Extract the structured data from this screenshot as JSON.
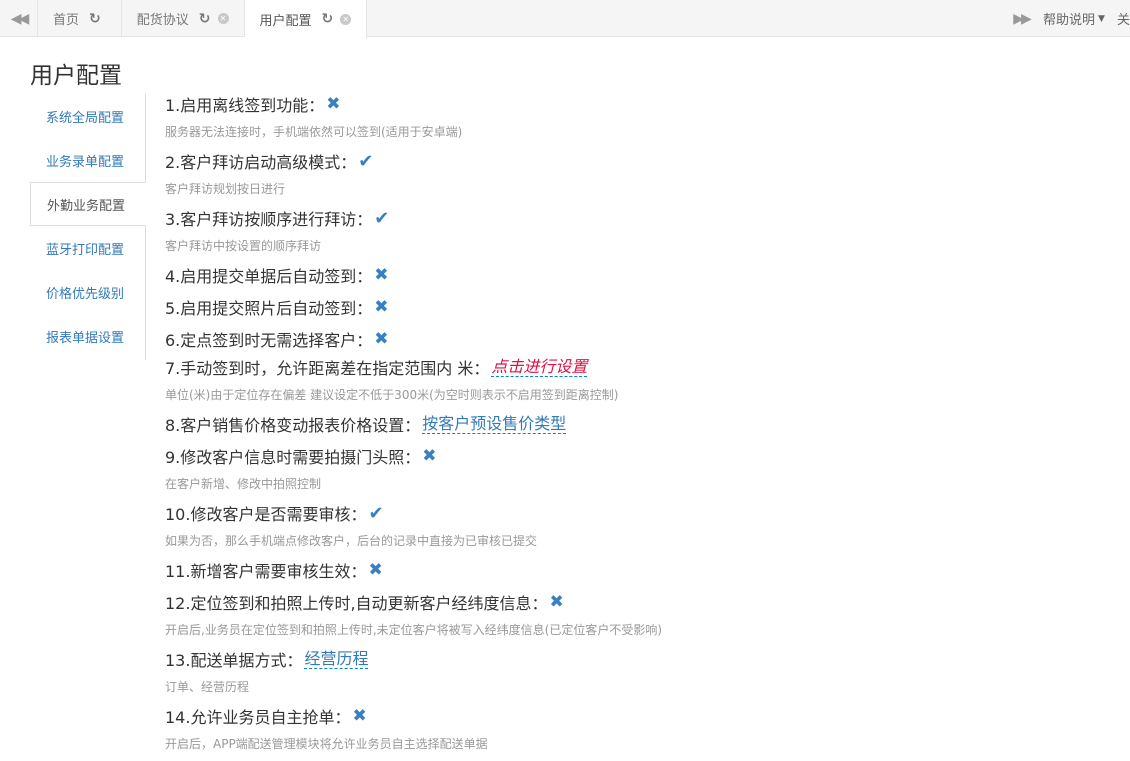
{
  "tabbar": {
    "tabs": [
      {
        "label": "首页",
        "closable": false
      },
      {
        "label": "配货协议",
        "closable": true
      },
      {
        "label": "用户配置",
        "closable": true,
        "active": true
      }
    ],
    "help_label": "帮助说明",
    "more_label": "关"
  },
  "page_title": "用户配置",
  "sidebar": {
    "items": [
      {
        "label": "系统全局配置"
      },
      {
        "label": "业务录单配置"
      },
      {
        "label": "外勤业务配置",
        "active": true
      },
      {
        "label": "蓝牙打印配置"
      },
      {
        "label": "价格优先级别"
      },
      {
        "label": "报表单据设置"
      }
    ]
  },
  "settings": [
    {
      "title": "1.启用离线签到功能：",
      "value": "off",
      "desc": "服务器无法连接时，手机端依然可以签到(适用于安卓端)"
    },
    {
      "title": "2.客户拜访启动高级模式：",
      "value": "on",
      "desc": "客户拜访规划按日进行"
    },
    {
      "title": "3.客户拜访按顺序进行拜访：",
      "value": "on",
      "desc": "客户拜访中按设置的顺序拜访"
    },
    {
      "title": "4.启用提交单据后自动签到：",
      "value": "off"
    },
    {
      "title": "5.启用提交照片后自动签到：",
      "value": "off"
    },
    {
      "title": "6.定点签到时无需选择客户：",
      "value": "off"
    },
    {
      "title": "7.手动签到时，允许距离差在指定范围内 米：",
      "link": "点击进行设置",
      "desc": "单位(米)由于定位存在偏差 建议设定不低于300米(为空时则表示不启用签到距离控制)"
    },
    {
      "title": "8.客户销售价格变动报表价格设置：",
      "link_value": "按客户预设售价类型"
    },
    {
      "title": "9.修改客户信息时需要拍摄门头照：",
      "value": "off",
      "desc": "在客户新增、修改中拍照控制"
    },
    {
      "title": "10.修改客户是否需要审核：",
      "value": "on",
      "desc": "如果为否，那么手机端点修改客户，后台的记录中直接为已审核已提交"
    },
    {
      "title": "11.新增客户需要审核生效：",
      "value": "off"
    },
    {
      "title": "12.定位签到和拍照上传时,自动更新客户经纬度信息：",
      "value": "off",
      "desc": "开启后,业务员在定位签到和拍照上传时,未定位客户将被写入经纬度信息(已定位客户不受影响)"
    },
    {
      "title": "13.配送单据方式：",
      "link_value": "经营历程",
      "desc": "订单、经营历程"
    },
    {
      "title": "14.允许业务员自主抢单：",
      "value": "off",
      "desc": "开启后，APP端配送管理模块将允许业务员自主选择配送单据"
    }
  ],
  "icons": {
    "on": "check-icon",
    "off": "cross-icon"
  },
  "colors": {
    "accent": "#3a7fc1",
    "link": "#337ab7",
    "setting_link": "#dd1144"
  }
}
